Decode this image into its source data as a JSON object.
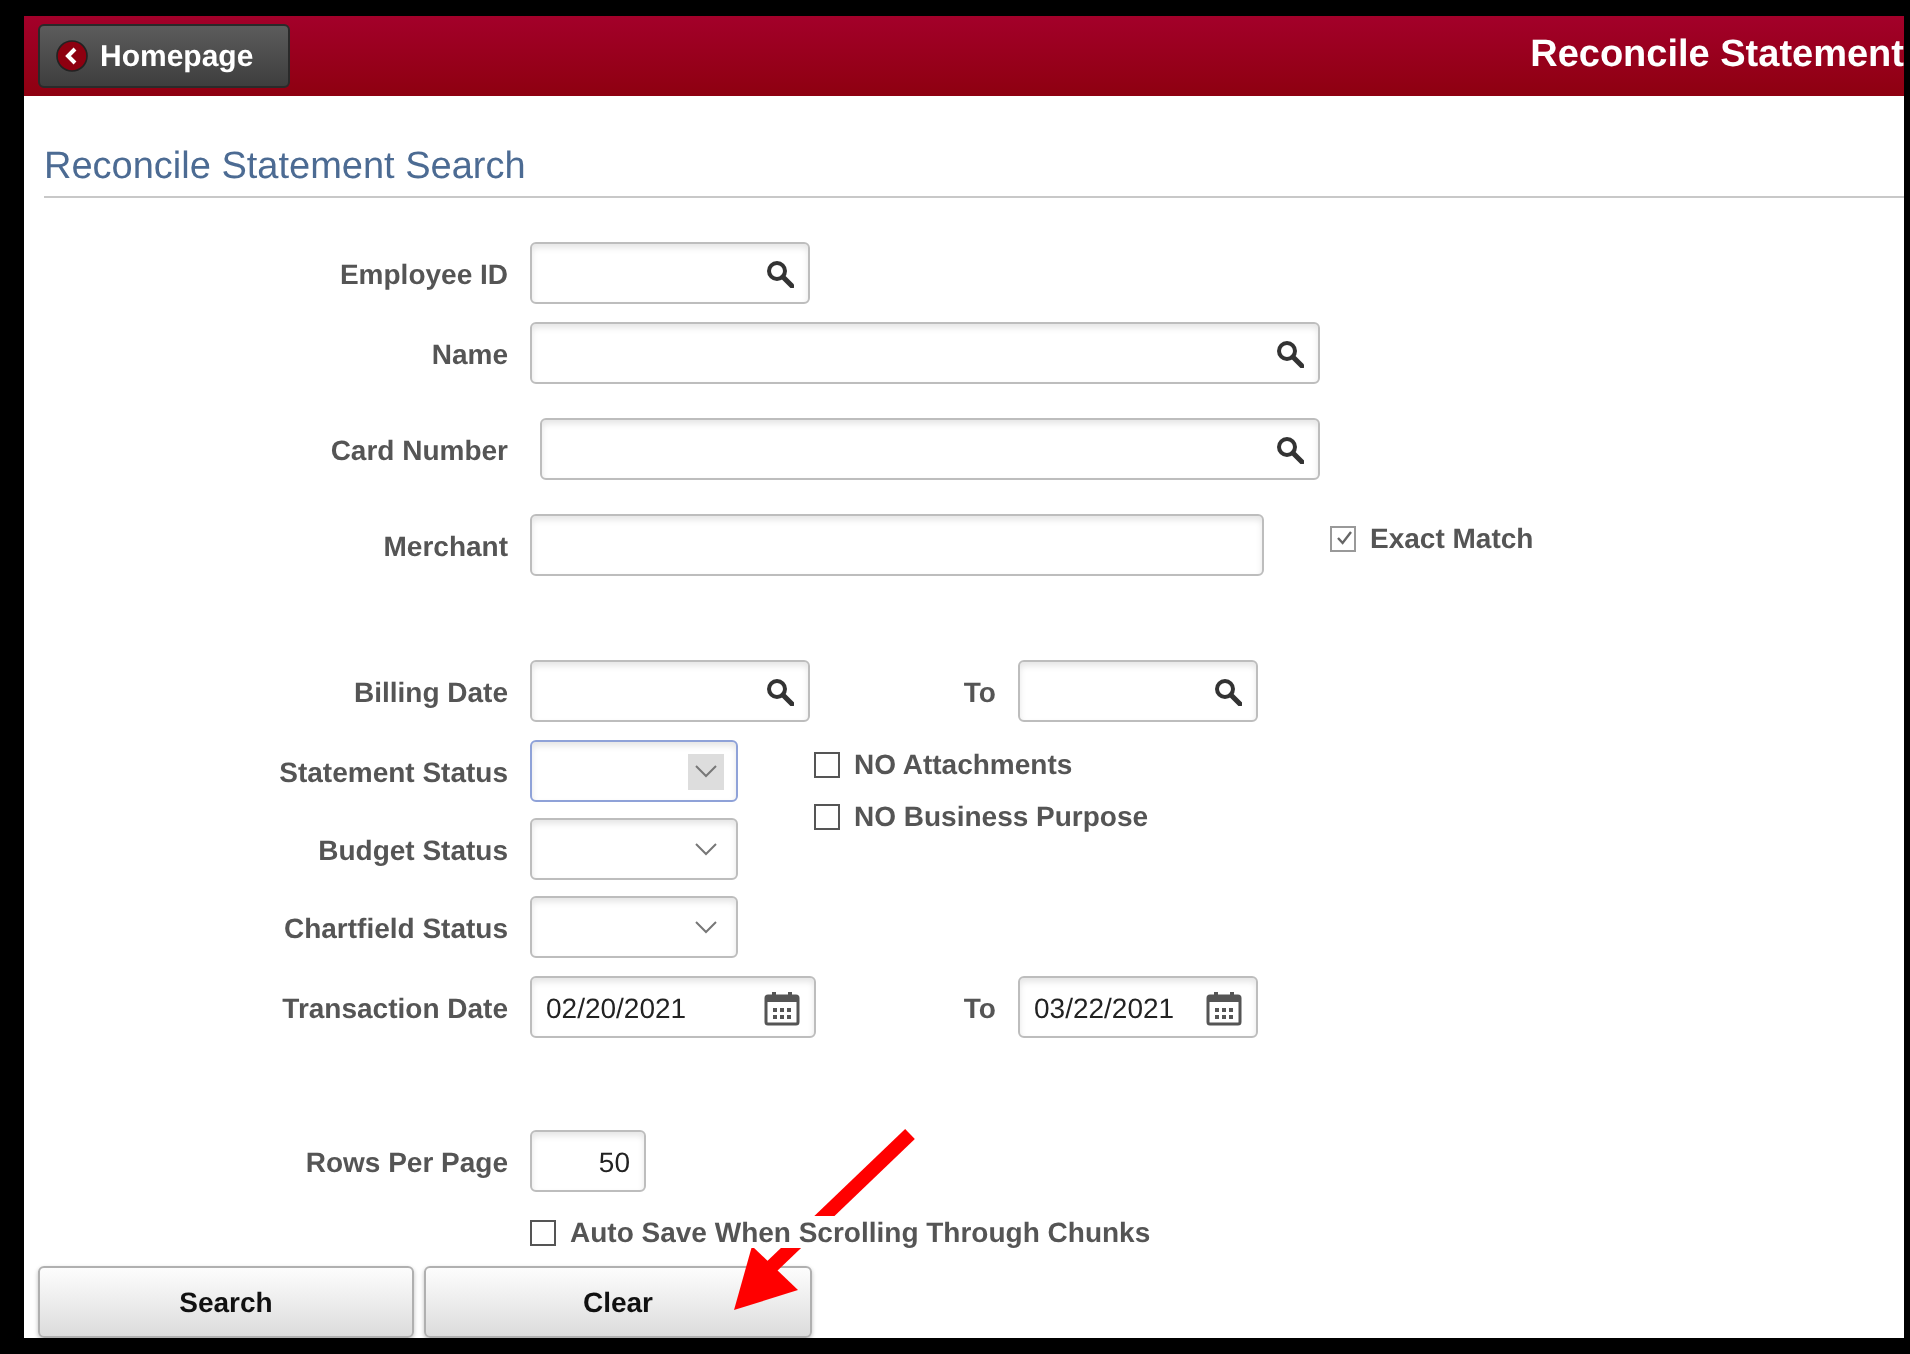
{
  "header": {
    "back_button": "Homepage",
    "title": "Reconcile Statement"
  },
  "page_title": "Reconcile Statement Search",
  "fields": [
    {
      "kind": "lookup",
      "label": "Employee ID"
    },
    {
      "kind": "lookup",
      "label": "Name"
    },
    {
      "kind": "lookup",
      "label": "Card Number"
    },
    {
      "kind": "text",
      "label": "Merchant",
      "checkbox": {
        "label": "Exact Match",
        "checked": true,
        "disabled": true
      }
    },
    {
      "kind": "lookup-range",
      "label": "Billing Date",
      "to_label": "To"
    },
    {
      "kind": "select",
      "label": "Statement Status",
      "focused": true
    },
    {
      "kind": "select",
      "label": "Budget Status",
      "focused": false
    },
    {
      "kind": "select",
      "label": "Chartfield Status",
      "focused": false
    },
    {
      "kind": "date-range",
      "label": "Transaction Date",
      "value": "02/20/2021",
      "to_label": "To",
      "to_value": "03/22/2021"
    },
    {
      "kind": "number",
      "label": "Rows Per Page",
      "value": "50"
    }
  ],
  "side_checkboxes": [
    {
      "label": "NO Attachments",
      "checked": false
    },
    {
      "label": "NO Business Purpose",
      "checked": false
    }
  ],
  "auto_save": {
    "label": "Auto Save When Scrolling Through Chunks",
    "checked": false
  },
  "buttons": [
    "Search",
    "Clear"
  ],
  "annotations": [
    {
      "kind": "arrow"
    }
  ]
}
